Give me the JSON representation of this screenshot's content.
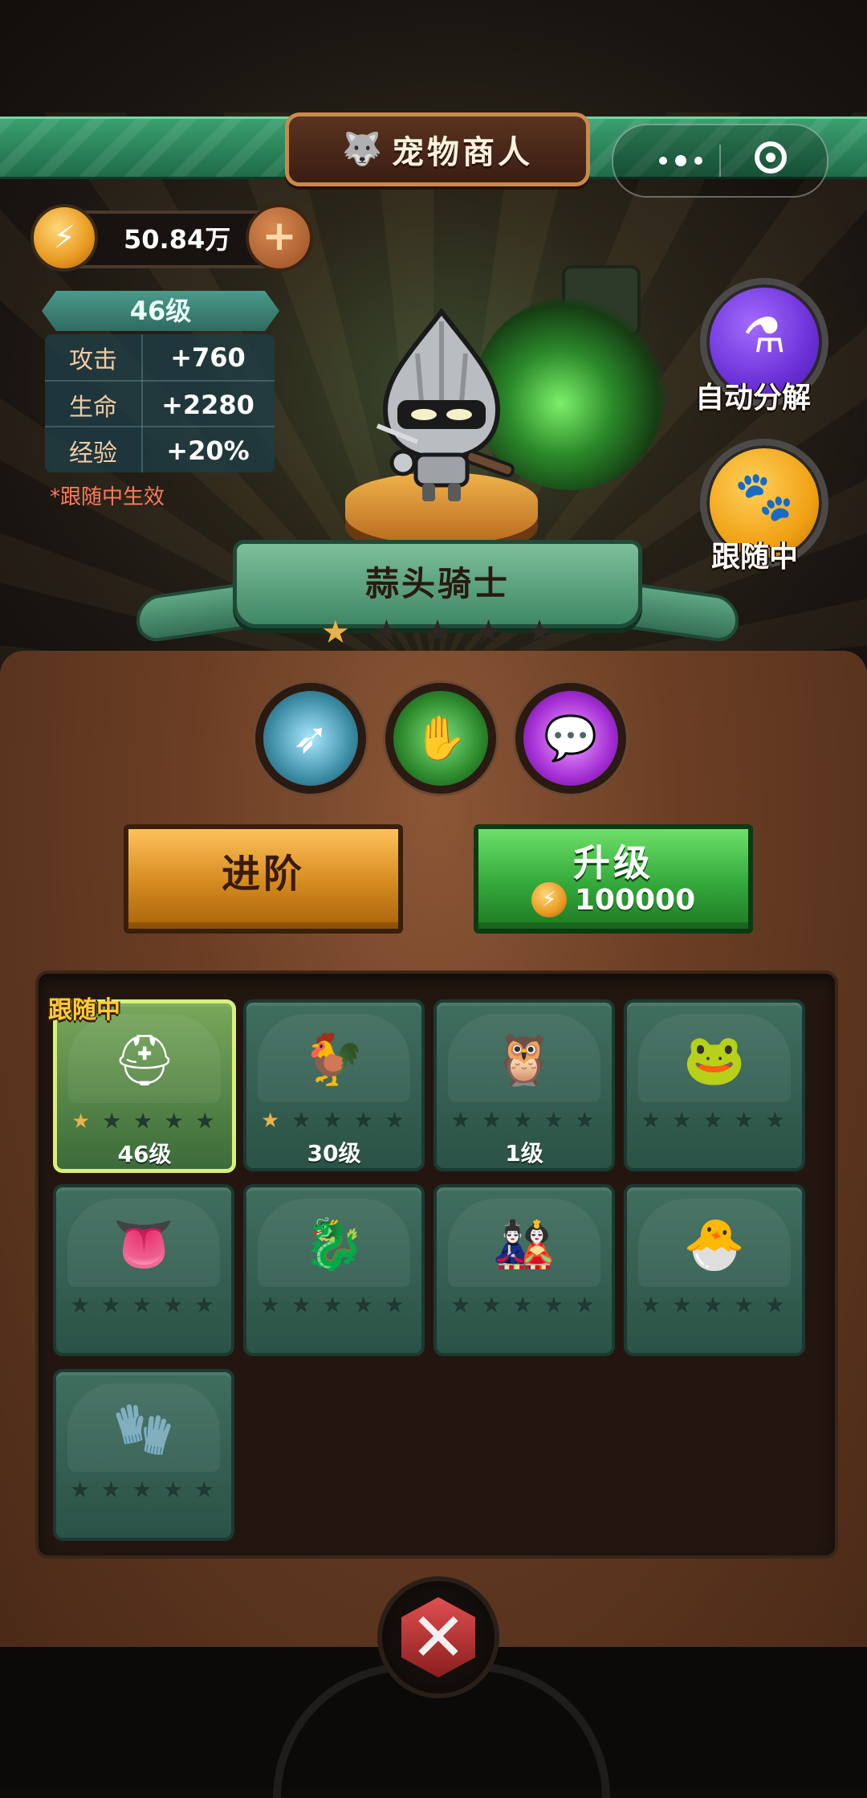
{
  "header": {
    "title": "宠物商人",
    "title_icon": "dog-head-icon",
    "capsule": {
      "more_icon": "more-dots-icon",
      "close_icon": "target-close-icon"
    }
  },
  "currency": {
    "amount": "50.84万",
    "coin_icon": "coin-icon",
    "add_icon": "plus-icon"
  },
  "pet_stats": {
    "level": "46级",
    "rows": [
      {
        "label": "攻击",
        "value": "+760"
      },
      {
        "label": "生命",
        "value": "+2280"
      },
      {
        "label": "经验",
        "value": "+20%"
      }
    ],
    "note": "*跟随中生效"
  },
  "side_buttons": {
    "auto_decompose": "自动分解",
    "following": "跟随中"
  },
  "selected_pet": {
    "name": "蒜头骑士",
    "stars_total": 5,
    "stars_on": 1
  },
  "skills": [
    "dash-skill-icon",
    "claw-skill-icon",
    "chat-bubble-skill-icon"
  ],
  "actions": {
    "advance": "进阶",
    "upgrade": "升级",
    "upgrade_cost": "100000"
  },
  "grid": {
    "follow_tag": "跟随中",
    "pets": [
      {
        "id": "garlic-knight",
        "icon": "⛑",
        "stars_on": 1,
        "level": "46级",
        "selected": true
      },
      {
        "id": "rooster",
        "icon": "🐓",
        "stars_on": 1,
        "level": "30级",
        "selected": false
      },
      {
        "id": "owl-deer",
        "icon": "🦉",
        "stars_on": 0,
        "level": "1级",
        "selected": false
      },
      {
        "id": "green-frog",
        "icon": "🐸",
        "stars_on": 0,
        "level": "",
        "selected": false
      },
      {
        "id": "tongue-monster",
        "icon": "👅",
        "stars_on": 0,
        "level": "",
        "selected": false
      },
      {
        "id": "red-dragon",
        "icon": "🐉",
        "stars_on": 0,
        "level": "",
        "selected": false
      },
      {
        "id": "daruma",
        "icon": "🎎",
        "stars_on": 0,
        "level": "",
        "selected": false
      },
      {
        "id": "egg-bird",
        "icon": "🐣",
        "stars_on": 0,
        "level": "",
        "selected": false
      },
      {
        "id": "gauntlet",
        "icon": "🧤",
        "stars_on": 0,
        "level": "",
        "selected": false
      }
    ]
  },
  "footer": {
    "close_icon": "crossed-swords-close-icon"
  }
}
